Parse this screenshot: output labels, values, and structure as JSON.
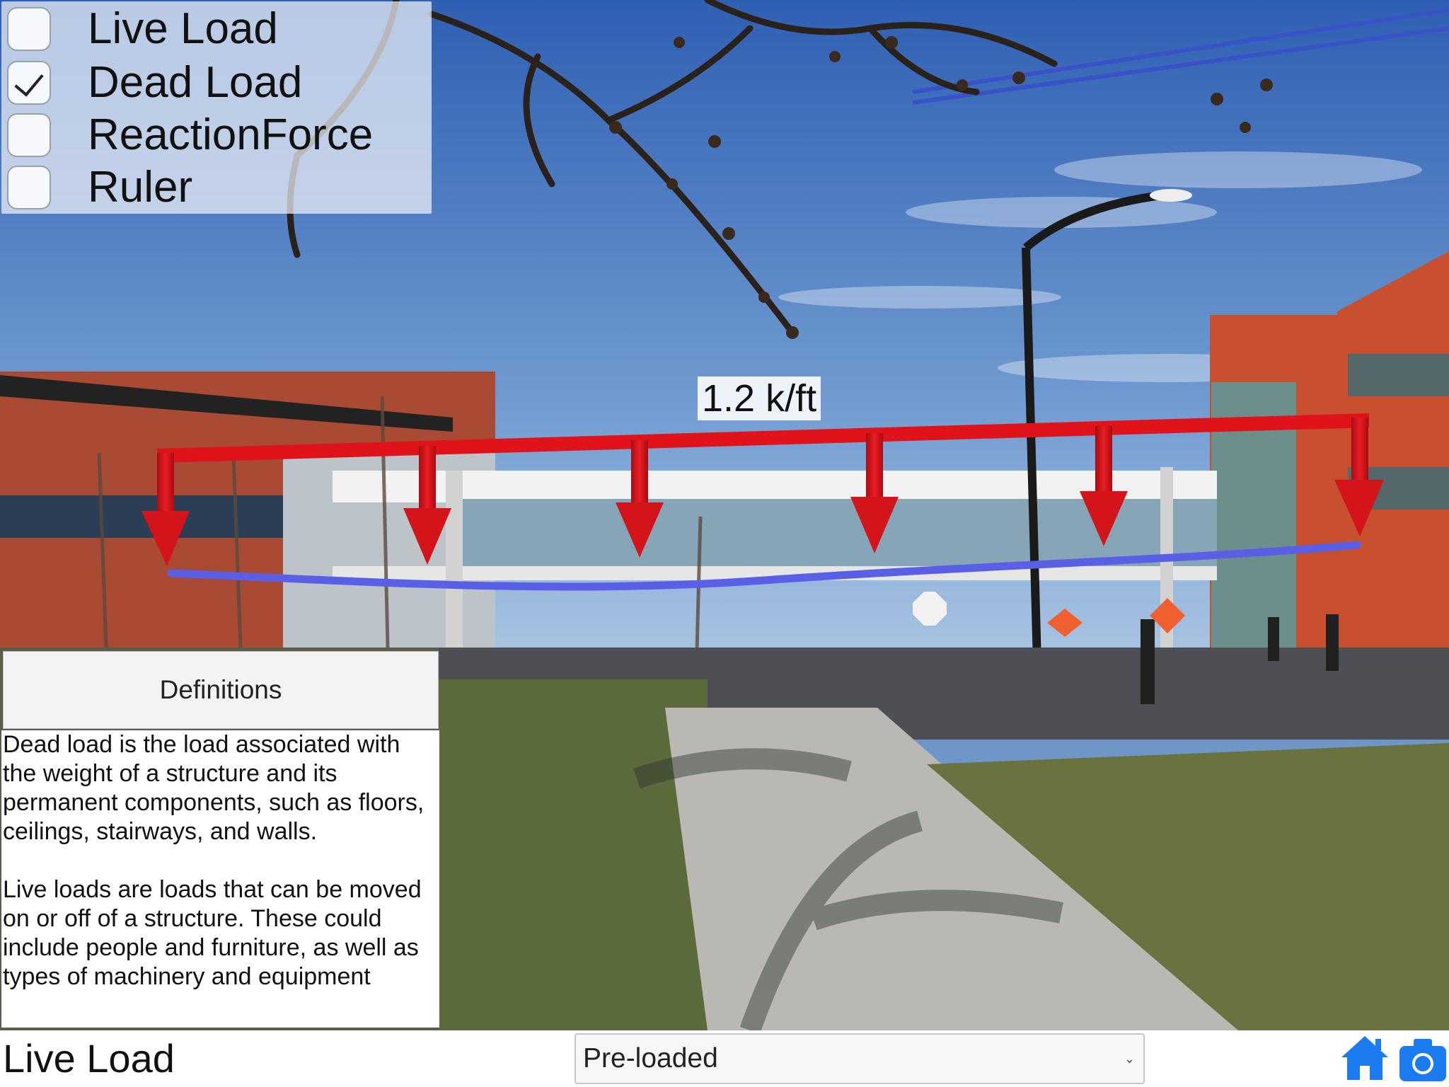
{
  "layers": {
    "items": [
      {
        "label": "Live Load",
        "checked": false
      },
      {
        "label": "Dead Load",
        "checked": true
      },
      {
        "label": "ReactionForce",
        "checked": false
      },
      {
        "label": "Ruler",
        "checked": false
      }
    ]
  },
  "overlay": {
    "load_magnitude": "1.2 k/ft",
    "load_arrow_color": "#e0121a",
    "deflection_color": "#5a60e6"
  },
  "definitions": {
    "button_label": "Definitions",
    "dead_load_text": "Dead load is the load associated with the weight of a structure and its permanent components, such as floors, ceilings, stairways, and walls.",
    "live_load_text": "Live loads are loads that can be moved on or off of a structure. These could include people and furniture, as well as types of machinery and equipment"
  },
  "bottom_bar": {
    "title": "Live Load",
    "select_value": "Pre-loaded",
    "home_icon": "home-icon",
    "camera_icon": "camera-icon",
    "icon_color": "#1a7cf0"
  }
}
